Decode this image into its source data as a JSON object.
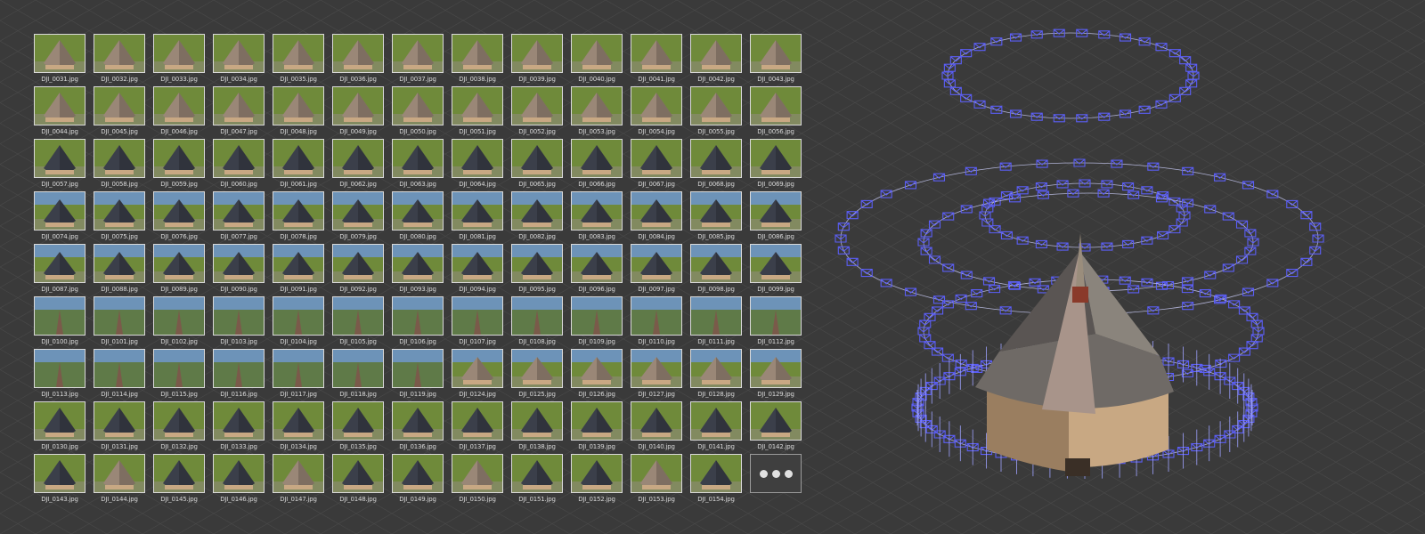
{
  "thumbnails": [
    "DJI_0031.jpg",
    "DJI_0032.jpg",
    "DJI_0033.jpg",
    "DJI_0034.jpg",
    "DJI_0035.jpg",
    "DJI_0036.jpg",
    "DJI_0037.jpg",
    "DJI_0038.jpg",
    "DJI_0039.jpg",
    "DJI_0040.jpg",
    "DJI_0041.jpg",
    "DJI_0042.jpg",
    "DJI_0043.jpg",
    "DJI_0044.jpg",
    "DJI_0045.jpg",
    "DJI_0046.jpg",
    "DJI_0047.jpg",
    "DJI_0048.jpg",
    "DJI_0049.jpg",
    "DJI_0050.jpg",
    "DJI_0051.jpg",
    "DJI_0052.jpg",
    "DJI_0053.jpg",
    "DJI_0054.jpg",
    "DJI_0055.jpg",
    "DJI_0056.jpg",
    "DJI_0057.jpg",
    "DJI_0058.jpg",
    "DJI_0059.jpg",
    "DJI_0060.jpg",
    "DJI_0061.jpg",
    "DJI_0062.jpg",
    "DJI_0063.jpg",
    "DJI_0064.jpg",
    "DJI_0065.jpg",
    "DJI_0066.jpg",
    "DJI_0067.jpg",
    "DJI_0068.jpg",
    "DJI_0069.jpg",
    "DJI_0074.jpg",
    "DJI_0075.jpg",
    "DJI_0076.jpg",
    "DJI_0077.jpg",
    "DJI_0078.jpg",
    "DJI_0079.jpg",
    "DJI_0080.jpg",
    "DJI_0081.jpg",
    "DJI_0082.jpg",
    "DJI_0083.jpg",
    "DJI_0084.jpg",
    "DJI_0085.jpg",
    "DJI_0086.jpg",
    "DJI_0087.jpg",
    "DJI_0088.jpg",
    "DJI_0089.jpg",
    "DJI_0090.jpg",
    "DJI_0091.jpg",
    "DJI_0092.jpg",
    "DJI_0093.jpg",
    "DJI_0094.jpg",
    "DJI_0095.jpg",
    "DJI_0096.jpg",
    "DJI_0097.jpg",
    "DJI_0098.jpg",
    "DJI_0099.jpg",
    "DJI_0100.jpg",
    "DJI_0101.jpg",
    "DJI_0102.jpg",
    "DJI_0103.jpg",
    "DJI_0104.jpg",
    "DJI_0105.jpg",
    "DJI_0106.jpg",
    "DJI_0107.jpg",
    "DJI_0108.jpg",
    "DJI_0109.jpg",
    "DJI_0110.jpg",
    "DJI_0111.jpg",
    "DJI_0112.jpg",
    "DJI_0113.jpg",
    "DJI_0114.jpg",
    "DJI_0115.jpg",
    "DJI_0116.jpg",
    "DJI_0117.jpg",
    "DJI_0118.jpg",
    "DJI_0119.jpg",
    "DJI_0124.jpg",
    "DJI_0125.jpg",
    "DJI_0126.jpg",
    "DJI_0127.jpg",
    "DJI_0128.jpg",
    "DJI_0129.jpg",
    "DJI_0130.jpg",
    "DJI_0131.jpg",
    "DJI_0132.jpg",
    "DJI_0133.jpg",
    "DJI_0134.jpg",
    "DJI_0135.jpg",
    "DJI_0136.jpg",
    "DJI_0137.jpg",
    "DJI_0138.jpg",
    "DJI_0139.jpg",
    "DJI_0140.jpg",
    "DJI_0141.jpg",
    "DJI_0142.jpg",
    "DJI_0143.jpg",
    "DJI_0144.jpg",
    "DJI_0145.jpg",
    "DJI_0146.jpg",
    "DJI_0147.jpg",
    "DJI_0148.jpg",
    "DJI_0149.jpg",
    "DJI_0150.jpg",
    "DJI_0151.jpg",
    "DJI_0152.jpg",
    "DJI_0153.jpg",
    "DJI_0154.jpg"
  ],
  "more_button": {
    "icon": "more-dots-icon"
  },
  "colors": {
    "background": "#3a3a3a",
    "grid_line": "#4a4a4a",
    "camera_frustum": "#5b5ef5",
    "roof_dark": "#3b3f4a",
    "roof_tan": "#9a8777",
    "grass": "#6f8a3a",
    "sky": "#6d93b8",
    "wall": "#c8a883"
  }
}
